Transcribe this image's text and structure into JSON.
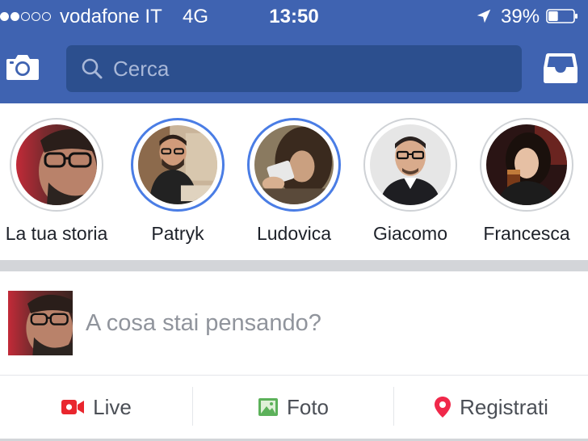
{
  "status_bar": {
    "carrier": "vodafone IT",
    "network": "4G",
    "time": "13:50",
    "battery_percent": "39%",
    "battery_level": 0.39,
    "signal_bars_filled": 2,
    "signal_bars_total": 5
  },
  "nav": {
    "camera_icon": "camera-icon",
    "search_icon": "search-icon",
    "search_placeholder": "Cerca",
    "inbox_icon": "inbox-icon"
  },
  "stories": [
    {
      "name": "La tua storia",
      "active": false
    },
    {
      "name": "Patryk",
      "active": true
    },
    {
      "name": "Ludovica",
      "active": true
    },
    {
      "name": "Giacomo",
      "active": false
    },
    {
      "name": "Francesca",
      "active": false
    }
  ],
  "composer": {
    "prompt": "A cosa stai pensando?"
  },
  "actions": {
    "live": {
      "label": "Live",
      "icon": "live-video-icon",
      "color": "#e9262e"
    },
    "photo": {
      "label": "Foto",
      "icon": "photo-icon",
      "color": "#5cb15a"
    },
    "checkin": {
      "label": "Registrati",
      "icon": "location-pin-icon",
      "color": "#f0284a"
    }
  },
  "colors": {
    "brand_blue": "#3f63b1",
    "search_bg": "#2c4f8e",
    "story_ring_active": "#4a7de5",
    "divider": "#d3d5d9"
  }
}
